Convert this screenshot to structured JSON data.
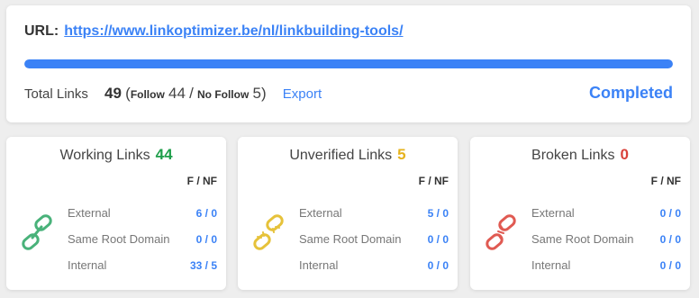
{
  "url_row": {
    "label": "URL:",
    "link": "https://www.linkoptimizer.be/nl/linkbuilding-tools/"
  },
  "progress": {
    "value": 1.0,
    "color": "#3b82f6"
  },
  "stats": {
    "total_label": "Total Links",
    "total_value": "49",
    "open_paren": "(",
    "follow_label": "Follow",
    "follow_value": "44",
    "separator": "/",
    "nofollow_label": "No Follow",
    "nofollow_value": "5)",
    "export_label": "Export",
    "status": "Completed"
  },
  "cards": {
    "working": {
      "title": "Working Links",
      "count": "44",
      "count_color": "#1e9e4a",
      "icon": "link-icon",
      "icon_color": "#49b27a",
      "header": "F / NF",
      "rows": [
        {
          "label": "External",
          "value": "6 / 0"
        },
        {
          "label": "Same Root Domain",
          "value": "0 / 0"
        },
        {
          "label": "Internal",
          "value": "33 / 5"
        }
      ]
    },
    "unverified": {
      "title": "Unverified Links",
      "count": "5",
      "count_color": "#e6b31e",
      "icon": "unverified-link-icon",
      "icon_color": "#e6c23a",
      "header": "F / NF",
      "rows": [
        {
          "label": "External",
          "value": "5 / 0"
        },
        {
          "label": "Same Root Domain",
          "value": "0 / 0"
        },
        {
          "label": "Internal",
          "value": "0 / 0"
        }
      ]
    },
    "broken": {
      "title": "Broken Links",
      "count": "0",
      "count_color": "#d9413a",
      "icon": "broken-link-icon",
      "icon_color": "#e05a52",
      "header": "F / NF",
      "rows": [
        {
          "label": "External",
          "value": "0 / 0"
        },
        {
          "label": "Same Root Domain",
          "value": "0 / 0"
        },
        {
          "label": "Internal",
          "value": "0 / 0"
        }
      ]
    }
  }
}
